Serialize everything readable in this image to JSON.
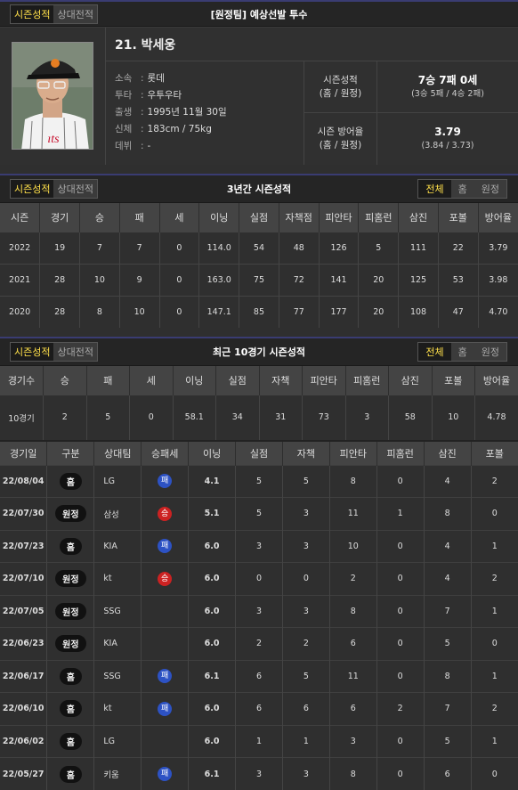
{
  "header": {
    "tabs": [
      "시즌성적",
      "상대전적"
    ],
    "title": "[원정팀] 예상선발 투수"
  },
  "player": {
    "name": "21. 박세웅",
    "details": [
      {
        "k": "소속",
        "v": "롯데"
      },
      {
        "k": "투타",
        "v": "우투우타"
      },
      {
        "k": "출생",
        "v": "1995년 11월 30일"
      },
      {
        "k": "신체",
        "v": "183cm / 75kg"
      },
      {
        "k": "데뷔",
        "v": "-"
      }
    ],
    "stats": [
      {
        "label1": "시즌성적",
        "label2": "(홈 / 원정)",
        "big": "7승 7패 0세",
        "small": "(3승 5패 / 4승 2패)"
      },
      {
        "label1": "시즌 방어율",
        "label2": "(홈 / 원정)",
        "big": "3.79",
        "small": "(3.84 / 3.73)"
      }
    ]
  },
  "three_year": {
    "tabs": [
      "시즌성적",
      "상대전적"
    ],
    "title": "3년간 시즌성적",
    "filters": [
      "전체",
      "홈",
      "원정"
    ],
    "headers": [
      "시즌",
      "경기",
      "승",
      "패",
      "세",
      "이닝",
      "실점",
      "자책점",
      "피안타",
      "피홈런",
      "삼진",
      "포볼",
      "방어율"
    ],
    "rows": [
      [
        "2022",
        "19",
        "7",
        "7",
        "0",
        "114.0",
        "54",
        "48",
        "126",
        "5",
        "111",
        "22",
        "3.79"
      ],
      [
        "2021",
        "28",
        "10",
        "9",
        "0",
        "163.0",
        "75",
        "72",
        "141",
        "20",
        "125",
        "53",
        "3.98"
      ],
      [
        "2020",
        "28",
        "8",
        "10",
        "0",
        "147.1",
        "85",
        "77",
        "177",
        "20",
        "108",
        "47",
        "4.70"
      ]
    ]
  },
  "recent": {
    "tabs": [
      "시즌성적",
      "상대전적"
    ],
    "title": "최근 10경기 시즌성적",
    "filters": [
      "전체",
      "홈",
      "원정"
    ],
    "headers": [
      "경기수",
      "승",
      "패",
      "세",
      "이닝",
      "실점",
      "자책",
      "피안타",
      "피홈런",
      "삼진",
      "포볼",
      "방어율"
    ],
    "row": [
      "10경기",
      "2",
      "5",
      "0",
      "58.1",
      "34",
      "31",
      "73",
      "3",
      "58",
      "10",
      "4.78"
    ]
  },
  "games": {
    "headers": [
      "경기일",
      "구분",
      "상대팀",
      "승패세",
      "이닝",
      "실점",
      "자책",
      "피안타",
      "피홈런",
      "삼진",
      "포볼"
    ],
    "rows": [
      {
        "date": "22/08/04",
        "type": "홈",
        "opp": "LG",
        "wl": "패",
        "wlc": "L",
        "ip": "4.1",
        "r": "5",
        "er": "5",
        "h": "8",
        "hr": "0",
        "so": "4",
        "bb": "2"
      },
      {
        "date": "22/07/30",
        "type": "원정",
        "opp": "삼성",
        "wl": "승",
        "wlc": "W",
        "ip": "5.1",
        "r": "5",
        "er": "3",
        "h": "11",
        "hr": "1",
        "so": "8",
        "bb": "0"
      },
      {
        "date": "22/07/23",
        "type": "홈",
        "opp": "KIA",
        "wl": "패",
        "wlc": "L",
        "ip": "6.0",
        "r": "3",
        "er": "3",
        "h": "10",
        "hr": "0",
        "so": "4",
        "bb": "1"
      },
      {
        "date": "22/07/10",
        "type": "원정",
        "opp": "kt",
        "wl": "승",
        "wlc": "W",
        "ip": "6.0",
        "r": "0",
        "er": "0",
        "h": "2",
        "hr": "0",
        "so": "4",
        "bb": "2"
      },
      {
        "date": "22/07/05",
        "type": "원정",
        "opp": "SSG",
        "wl": "",
        "wlc": "",
        "ip": "6.0",
        "r": "3",
        "er": "3",
        "h": "8",
        "hr": "0",
        "so": "7",
        "bb": "1"
      },
      {
        "date": "22/06/23",
        "type": "원정",
        "opp": "KIA",
        "wl": "",
        "wlc": "",
        "ip": "6.0",
        "r": "2",
        "er": "2",
        "h": "6",
        "hr": "0",
        "so": "5",
        "bb": "0"
      },
      {
        "date": "22/06/17",
        "type": "홈",
        "opp": "SSG",
        "wl": "패",
        "wlc": "L",
        "ip": "6.1",
        "r": "6",
        "er": "5",
        "h": "11",
        "hr": "0",
        "so": "8",
        "bb": "1"
      },
      {
        "date": "22/06/10",
        "type": "홈",
        "opp": "kt",
        "wl": "패",
        "wlc": "L",
        "ip": "6.0",
        "r": "6",
        "er": "6",
        "h": "6",
        "hr": "2",
        "so": "7",
        "bb": "2"
      },
      {
        "date": "22/06/02",
        "type": "홈",
        "opp": "LG",
        "wl": "",
        "wlc": "",
        "ip": "6.0",
        "r": "1",
        "er": "1",
        "h": "3",
        "hr": "0",
        "so": "5",
        "bb": "1"
      },
      {
        "date": "22/05/27",
        "type": "홈",
        "opp": "키움",
        "wl": "패",
        "wlc": "L",
        "ip": "6.1",
        "r": "3",
        "er": "3",
        "h": "8",
        "hr": "0",
        "so": "6",
        "bb": "0"
      }
    ]
  }
}
